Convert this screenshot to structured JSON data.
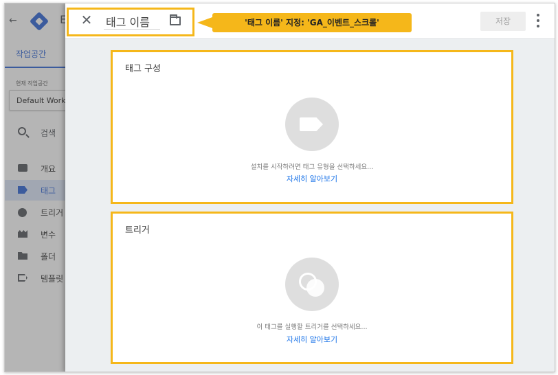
{
  "app": {
    "back_icon": "arrow-left-icon",
    "logo_icon": "gtm-logo-icon",
    "title_fragment": "E"
  },
  "sidebar": {
    "workspace_tab": "작업공간",
    "current_workspace_label": "현재 작업공간",
    "current_workspace_value": "Default Work",
    "search_label": "검색",
    "items": [
      {
        "label": "개요",
        "icon": "briefcase-icon",
        "active": false
      },
      {
        "label": "태그",
        "icon": "tag-icon",
        "active": true
      },
      {
        "label": "트리거",
        "icon": "trigger-icon",
        "active": false
      },
      {
        "label": "변수",
        "icon": "variables-icon",
        "active": false
      },
      {
        "label": "폴더",
        "icon": "folder-icon",
        "active": false
      },
      {
        "label": "템플릿",
        "icon": "template-icon",
        "active": false
      }
    ]
  },
  "editor": {
    "close_icon": "close-icon",
    "tag_name": "태그 이름",
    "folder_icon": "folder-outline-icon",
    "annotation": "'태그 이름' 지정: 'GA_이벤트_스크롤'",
    "save_label": "저장",
    "more_icon": "more-vert-icon",
    "highlight_color": "#f5b71a"
  },
  "tag_config": {
    "title": "태그 구성",
    "hint": "설치를 시작하려면 태그 유형을 선택하세요...",
    "learn_more": "자세히 알아보기"
  },
  "trigger_config": {
    "title": "트리거",
    "hint": "이 태그를 실행할 트리거를 선택하세요...",
    "learn_more": "자세히 알아보기"
  }
}
